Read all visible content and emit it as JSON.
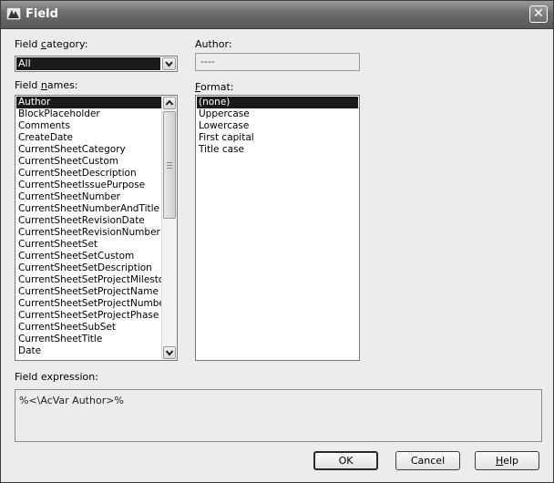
{
  "window": {
    "title": "Field",
    "close_glyph": "✕",
    "app_icon": "autocad-icon"
  },
  "field_category": {
    "label_pre": "Field ",
    "label_accel": "c",
    "label_post": "ategory:",
    "selected": "All"
  },
  "author": {
    "label": "Author:",
    "value": "----"
  },
  "field_names": {
    "label_pre": "Field ",
    "label_accel": "n",
    "label_post": "ames:",
    "selected_index": 0,
    "items": [
      "Author",
      "BlockPlaceholder",
      "Comments",
      "CreateDate",
      "CurrentSheetCategory",
      "CurrentSheetCustom",
      "CurrentSheetDescription",
      "CurrentSheetIssuePurpose",
      "CurrentSheetNumber",
      "CurrentSheetNumberAndTitle",
      "CurrentSheetRevisionDate",
      "CurrentSheetRevisionNumber",
      "CurrentSheetSet",
      "CurrentSheetSetCustom",
      "CurrentSheetSetDescription",
      "CurrentSheetSetProjectMilestone",
      "CurrentSheetSetProjectName",
      "CurrentSheetSetProjectNumber",
      "CurrentSheetSetProjectPhase",
      "CurrentSheetSubSet",
      "CurrentSheetTitle",
      "Date"
    ]
  },
  "format": {
    "label_accel": "F",
    "label_post": "ormat:",
    "selected_index": 0,
    "items": [
      "(none)",
      "Uppercase",
      "Lowercase",
      "First capital",
      "Title case"
    ]
  },
  "field_expression": {
    "label": "Field expression:",
    "value": "%<\\AcVar Author>%"
  },
  "buttons": {
    "ok": "OK",
    "cancel": "Cancel",
    "help_accel": "H",
    "help_post": "elp"
  }
}
